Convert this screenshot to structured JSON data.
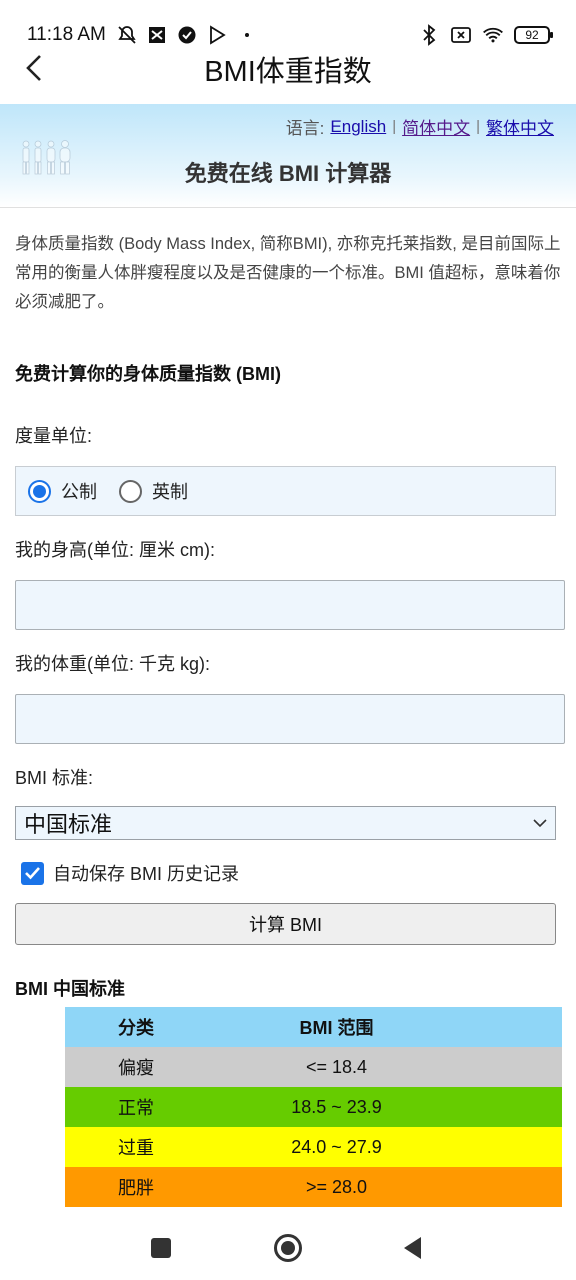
{
  "status": {
    "time": "11:18 AM",
    "battery": "92"
  },
  "appbar": {
    "title": "BMI体重指数"
  },
  "header": {
    "lang_prefix": "语言:",
    "lang_english": "English",
    "lang_simplified": "简体中文",
    "lang_traditional": "繁体中文",
    "site_title": "免费在线 BMI 计算器"
  },
  "content": {
    "intro": "身体质量指数 (Body Mass Index, 简称BMI), 亦称克托莱指数, 是目前国际上常用的衡量人体胖瘦程度以及是否健康的一个标准。BMI 值超标，意味着你必须减肥了。",
    "section_title": "免费计算你的身体质量指数 (BMI)",
    "unit_label": "度量单位:",
    "unit_metric": "公制",
    "unit_imperial": "英制",
    "height_label": "我的身高(单位: 厘米 cm):",
    "height_value": "",
    "weight_label": "我的体重(单位: 千克 kg):",
    "weight_value": "",
    "standard_label": "BMI 标准:",
    "standard_selected": "中国标准",
    "autosave_label": "自动保存 BMI 历史记录",
    "calc_button": "计算 BMI",
    "table_title": "BMI 中国标准"
  },
  "table": {
    "headers": [
      "分类",
      "BMI 范围"
    ],
    "rows": [
      {
        "category": "偏瘦",
        "range": "<= 18.4",
        "color": "#cccccc"
      },
      {
        "category": "正常",
        "range": "18.5 ~ 23.9",
        "color": "#66cc00"
      },
      {
        "category": "过重",
        "range": "24.0 ~ 27.9",
        "color": "#ffff00"
      },
      {
        "category": "肥胖",
        "range": ">= 28.0",
        "color": "#ff9900"
      }
    ]
  }
}
